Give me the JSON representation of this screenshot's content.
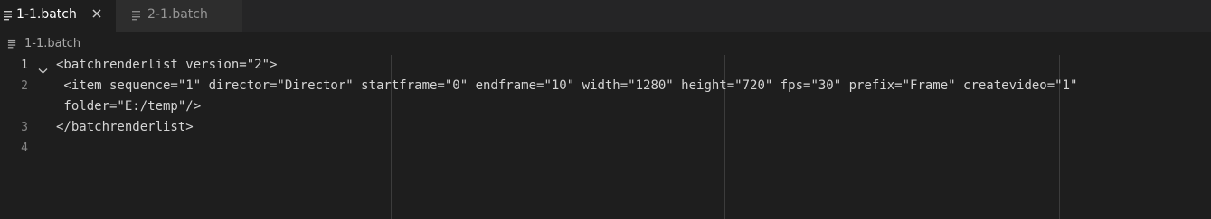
{
  "tabs": [
    {
      "label": "1-1.batch",
      "active": true,
      "icon": "file-lines-icon",
      "close_icon": "close-icon"
    },
    {
      "label": "2-1.batch",
      "active": false,
      "icon": "file-lines-icon"
    }
  ],
  "breadcrumb": {
    "icon": "file-lines-icon",
    "label": "1-1.batch"
  },
  "editor": {
    "line_numbers": [
      "1",
      "2",
      "3",
      "4"
    ],
    "lines": [
      "<batchrenderlist version=\"2\">",
      " <item sequence=\"1\" director=\"Director\" startframe=\"0\" endframe=\"10\" width=\"1280\" height=\"720\" fps=\"30\" prefix=\"Frame\" createvideo=\"1\"",
      " folder=\"E:/temp\"/>",
      "</batchrenderlist>",
      ""
    ],
    "fold_icon": "chevron-down-icon"
  },
  "colors": {
    "editor_bg": "#1e1e1e",
    "tabbar_bg": "#252526",
    "text": "#d4d4d4",
    "line_number": "#858585",
    "ruler": "#3c3c3c"
  }
}
